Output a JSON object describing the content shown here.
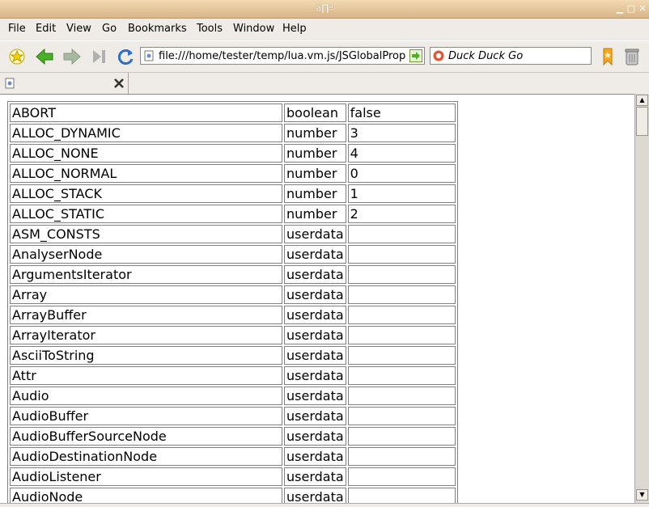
{
  "window": {
    "title": "â∏ª"
  },
  "menu": {
    "file": "File",
    "edit": "Edit",
    "view": "View",
    "go": "Go",
    "bookmarks": "Bookmarks",
    "tools": "Tools",
    "window": "Window",
    "help": "Help"
  },
  "toolbar": {
    "url": "file:///home/tester/temp/lua.vm.js/JSGlobalPrope",
    "search_engine": "Duck Duck Go"
  },
  "colors": {
    "titlebar": "#d9b488",
    "back_arrow": "#4caf2a",
    "reload": "#2a6fc8"
  },
  "table": {
    "rows": [
      [
        "ABORT",
        "boolean",
        "false"
      ],
      [
        "ALLOC_DYNAMIC",
        "number",
        "3"
      ],
      [
        "ALLOC_NONE",
        "number",
        "4"
      ],
      [
        "ALLOC_NORMAL",
        "number",
        "0"
      ],
      [
        "ALLOC_STACK",
        "number",
        "1"
      ],
      [
        "ALLOC_STATIC",
        "number",
        "2"
      ],
      [
        "ASM_CONSTS",
        "userdata",
        ""
      ],
      [
        "AnalyserNode",
        "userdata",
        ""
      ],
      [
        "ArgumentsIterator",
        "userdata",
        ""
      ],
      [
        "Array",
        "userdata",
        ""
      ],
      [
        "ArrayBuffer",
        "userdata",
        ""
      ],
      [
        "ArrayIterator",
        "userdata",
        ""
      ],
      [
        "AsciiToString",
        "userdata",
        ""
      ],
      [
        "Attr",
        "userdata",
        ""
      ],
      [
        "Audio",
        "userdata",
        ""
      ],
      [
        "AudioBuffer",
        "userdata",
        ""
      ],
      [
        "AudioBufferSourceNode",
        "userdata",
        ""
      ],
      [
        "AudioDestinationNode",
        "userdata",
        ""
      ],
      [
        "AudioListener",
        "userdata",
        ""
      ],
      [
        "AudioNode",
        "userdata",
        ""
      ]
    ]
  }
}
